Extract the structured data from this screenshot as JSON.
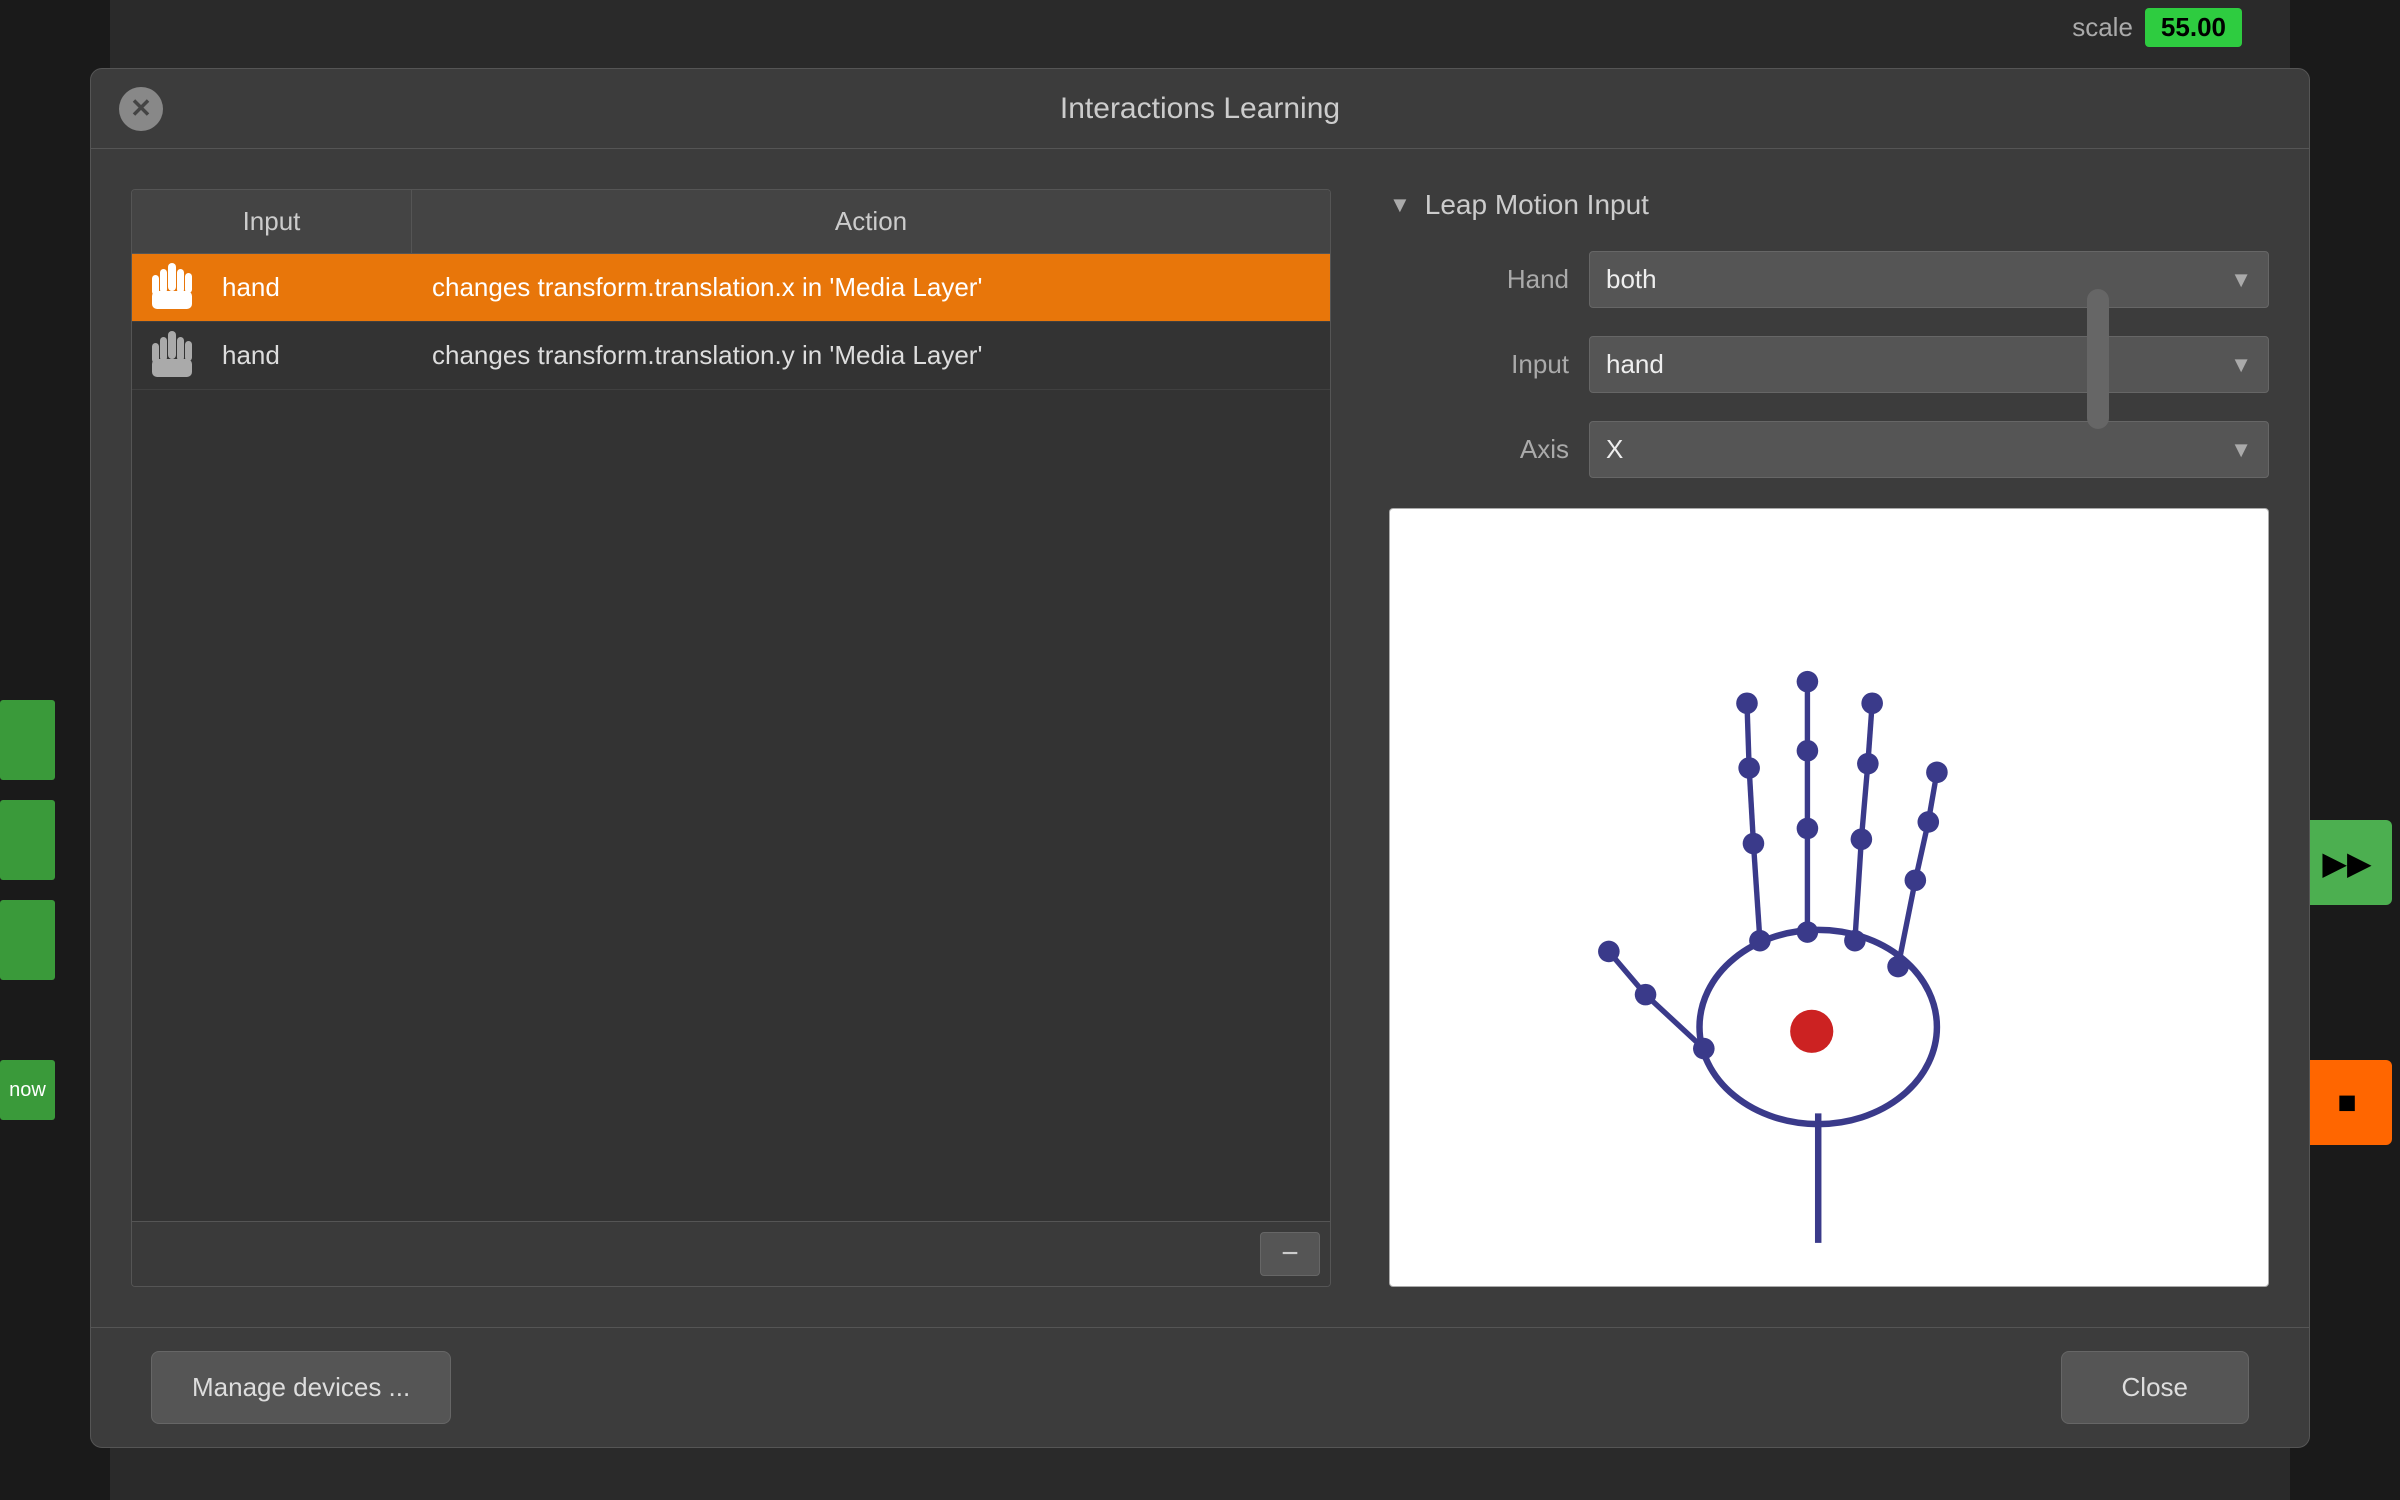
{
  "window": {
    "title": "Interactions Learning"
  },
  "scale": {
    "label": "scale",
    "value": "55.00"
  },
  "table": {
    "col_input": "Input",
    "col_action": "Action",
    "rows": [
      {
        "id": 0,
        "icon": "hand",
        "input": "hand",
        "action": "changes transform.translation.x in 'Media Layer'",
        "selected": true
      },
      {
        "id": 1,
        "icon": "hand",
        "input": "hand",
        "action": "changes transform.translation.y in 'Media Layer'",
        "selected": false
      }
    ],
    "remove_btn": "−"
  },
  "leap_panel": {
    "title": "Leap Motion Input",
    "hand_label": "Hand",
    "hand_value": "both",
    "input_label": "Input",
    "input_value": "hand",
    "axis_label": "Axis",
    "axis_value": "X"
  },
  "footer": {
    "manage_label": "Manage devices ...",
    "close_label": "Close"
  },
  "right_buttons": {
    "play_icon": "▶▶",
    "stop_icon": "■"
  }
}
